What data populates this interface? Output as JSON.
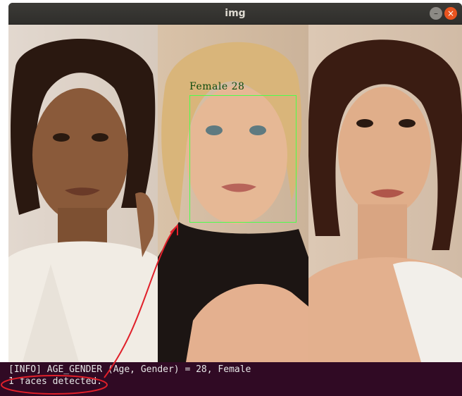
{
  "window": {
    "title": "img",
    "minimize_glyph": "–",
    "close_glyph": "×"
  },
  "detection": {
    "label": "Female 28"
  },
  "terminal": {
    "line1": "[INFO] AGE_GENDER (Age, Gender) = 28, Female",
    "line2": "1 faces detected.",
    "line3": ""
  },
  "colors": {
    "box": "#4cff4c",
    "annotation": "#e0202a",
    "terminal_bg": "#300a24"
  }
}
